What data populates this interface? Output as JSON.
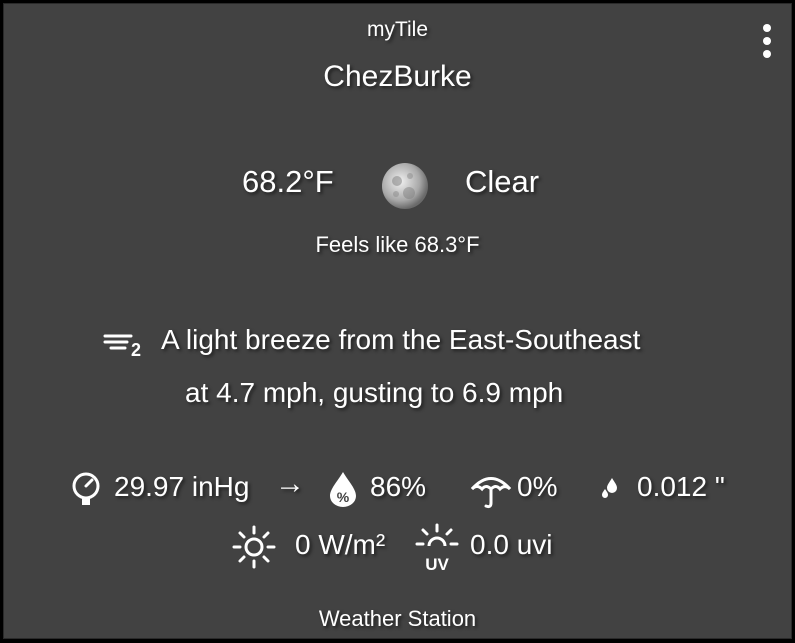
{
  "header": {
    "label": "myTile",
    "menu_icon": "more-vert-icon"
  },
  "station": {
    "name": "ChezBurke"
  },
  "current": {
    "temperature": "68.2°F",
    "condition_icon": "moon-icon",
    "condition": "Clear",
    "feels_like": "Feels like 68.3°F"
  },
  "wind": {
    "icon": "wind-icon",
    "line1": "A light breeze from the East-Southeast",
    "line2": "at 4.7 mph, gusting to 6.9 mph"
  },
  "metrics": {
    "pressure": {
      "icon": "gauge-icon",
      "value": "29.97 inHg",
      "trend": "→"
    },
    "humidity": {
      "icon": "humidity-drop-icon",
      "value": "86%"
    },
    "precip_chance": {
      "icon": "umbrella-icon",
      "value": "0%"
    },
    "rain": {
      "icon": "raindrops-icon",
      "value": "0.012 \""
    },
    "solar": {
      "icon": "sun-icon",
      "value": "0 W/m²"
    },
    "uv": {
      "icon": "uv-sun-icon",
      "value": "0.0 uvi"
    }
  },
  "footer": {
    "label": "Weather Station"
  },
  "colors": {
    "tile_bg": "#424242",
    "text": "#ffffff",
    "outer_bg": "#000000"
  }
}
